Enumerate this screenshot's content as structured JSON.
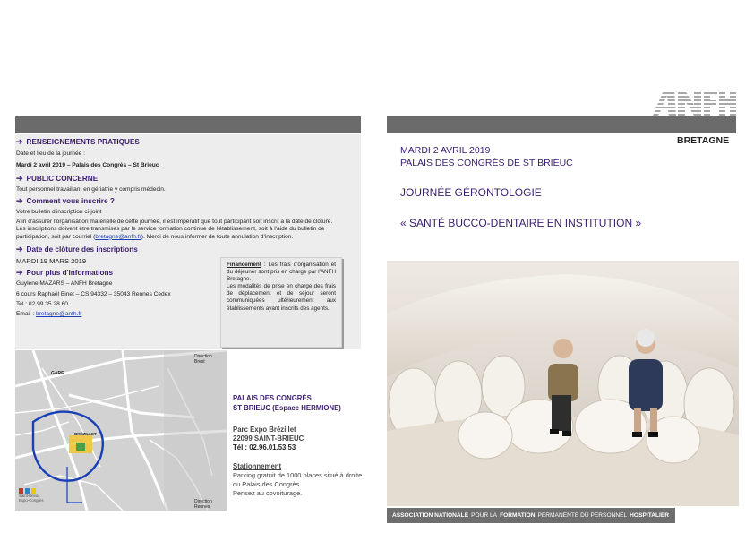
{
  "left": {
    "sections": {
      "info_heading": "RENSEIGNEMENTS PRATIQUES",
      "date_lieu_label": "Date et lieu de la journée :",
      "date_lieu_value": "Mardi 2 avril 2019 – Palais des Congrès – St Brieuc",
      "public_heading": "PUBLIC CONCERNE",
      "public_text": "Tout personnel travaillant en gériatrie y compris médecin.",
      "inscrire_heading": "Comment vous inscrire ?",
      "inscrire_text": "Votre bulletin d'inscription ci-joint",
      "inscrire_para1": "Afin d'assurer l'organisation matérielle de cette journée, il est impératif que tout participant soit inscrit à la date de clôture. Les inscriptions doivent être transmises par le service formation continue de l'établissement, soit à l'aide du bulletin de participation, soit par courriel (",
      "inscrire_email": "bretagne@anfh.fr",
      "inscrire_para2": "). Merci de nous informer de toute annulation d'inscription.",
      "cloture_heading": "Date de clôture des inscriptions",
      "cloture_value": "MARDI 19 MARS 2019",
      "plus_heading": "Pour plus d'informations",
      "contact_name": "Guylène MAZARS – ANFH Bretagne",
      "contact_address": "6 cours Raphaël Binet – CS 94332 – 35043 Rennes Cedex",
      "contact_tel": "Tel : 02 99 35 28 60",
      "contact_email_label": "Email : ",
      "contact_email": "bretagne@anfh.fr"
    },
    "financement": {
      "label": "Financement",
      "text1": " : Les frais d'organisation et du déjeuner sont pris en charge par l'ANFH Bretagne.",
      "text2": "Les modalités de prise en charge des frais de déplacement et de séjour seront communiquées ultérieurement aux établissements ayant inscrits des agents."
    },
    "map": {
      "label_gare": "GARE",
      "label_brest": "Direction Brest",
      "label_rennes": "Direction Rennes",
      "label_brezillet": "BRÉZILLET",
      "logo_text": "Saint-Brieuc Expo-Congrès"
    },
    "venue": {
      "title_line1": "PALAIS DES CONGRÈS",
      "title_line2": "ST BRIEUC (Espace HERMIONE)",
      "addr1": "Parc Expo Brézillet",
      "addr2": "22099 SAINT-BRIEUC",
      "tel": "Tél : 02.96.01.53.53",
      "parking_label": "Stationnement",
      "parking_text": "Parking gratuit de 1000 places situé à droite du Palais des Congrès.",
      "covoiturage": "Pensez au covoiturage."
    }
  },
  "right": {
    "region": "BRETAGNE",
    "date": "MARDI 2 AVRIL 2019",
    "place": "PALAIS DES CONGRÈS DE ST BRIEUC",
    "event": "JOURNÉE GÉRONTOLOGIE",
    "theme": "« SANTÉ BUCCO-DENTAIRE EN INSTITUTION »",
    "footer": {
      "w1": "ASSOCIATION NATIONALE",
      "w2": "POUR LA",
      "w3": "FORMATION",
      "w4": "PERMANENTE DU PERSONNEL",
      "w5": "HOSPITALIER"
    }
  },
  "colors": {
    "purple": "#3a1d6e",
    "grey_bar": "#6b6b6b",
    "link": "#1a3fb5"
  }
}
